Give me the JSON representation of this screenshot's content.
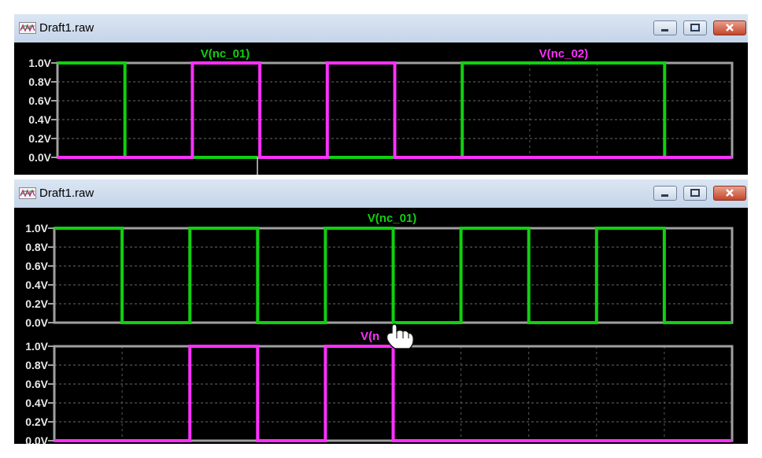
{
  "windows": [
    {
      "title": "Draft1.raw"
    },
    {
      "title": "Draft1.raw"
    }
  ],
  "colors": {
    "nc_01": "#10d010",
    "nc_02": "#ff30ff",
    "frame": "#a0a0a0",
    "background": "#000000"
  },
  "icons": {
    "window": "waveform-window-icon",
    "minimize": "minimize-icon",
    "maximize": "maximize-icon",
    "close": "close-icon",
    "cursor": "hand-cursor-icon"
  },
  "chart_data": [
    {
      "type": "line",
      "title": "Draft1.raw",
      "yticks": [
        "1.0V",
        "0.8V",
        "0.6V",
        "0.4V",
        "0.2V",
        "0.0V"
      ],
      "ylim": [
        0,
        1.0
      ],
      "x_divisions": 10,
      "series": [
        {
          "name": "V(nc_01)",
          "color": "#10d010",
          "levels": [
            1,
            0,
            0,
            0,
            0,
            0,
            1,
            1,
            1,
            0
          ]
        },
        {
          "name": "V(nc_02)",
          "color": "#ff30ff",
          "levels": [
            0,
            0,
            1,
            0,
            1,
            0,
            0,
            0,
            0,
            0
          ]
        }
      ]
    },
    {
      "type": "line",
      "title": "Draft1.raw",
      "panes": [
        {
          "yticks": [
            "1.0V",
            "0.8V",
            "0.6V",
            "0.4V",
            "0.2V",
            "0.0V"
          ],
          "ylim": [
            0,
            1.0
          ],
          "series": [
            {
              "name": "V(nc_01)",
              "color": "#10d010",
              "levels": [
                1,
                0,
                1,
                0,
                1,
                0,
                1,
                0,
                1,
                0
              ]
            }
          ]
        },
        {
          "yticks": [
            "1.0V",
            "0.8V",
            "0.6V",
            "0.4V",
            "0.2V",
            "0.0V"
          ],
          "ylim": [
            0,
            1.0
          ],
          "series": [
            {
              "name": "V(n",
              "color": "#ff30ff",
              "levels": [
                0,
                0,
                1,
                0,
                1,
                0,
                0,
                0,
                0,
                0
              ]
            }
          ]
        }
      ]
    }
  ]
}
